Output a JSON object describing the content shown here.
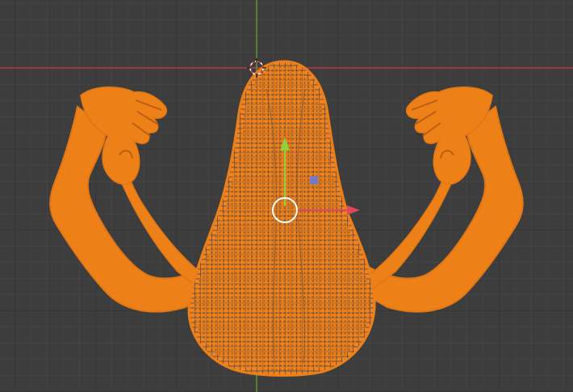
{
  "app": "blender-3d-viewport",
  "viewport": {
    "mode": "edit-mode",
    "selection": "all-vertices-selected",
    "selection_color": "#f28a20",
    "axis_x_color": "#b83c4d",
    "axis_y_color": "#6a9a2c",
    "grid_color": "#3d3d3d"
  },
  "gizmo": {
    "x_arrow_color": "#e0485a",
    "y_arrow_color": "#8bd43a",
    "plane_handle_color": "#6a7ad8",
    "rotate_ring_color": "#ffffff"
  },
  "cursor_3d": {
    "icon": "3d-cursor-icon"
  }
}
